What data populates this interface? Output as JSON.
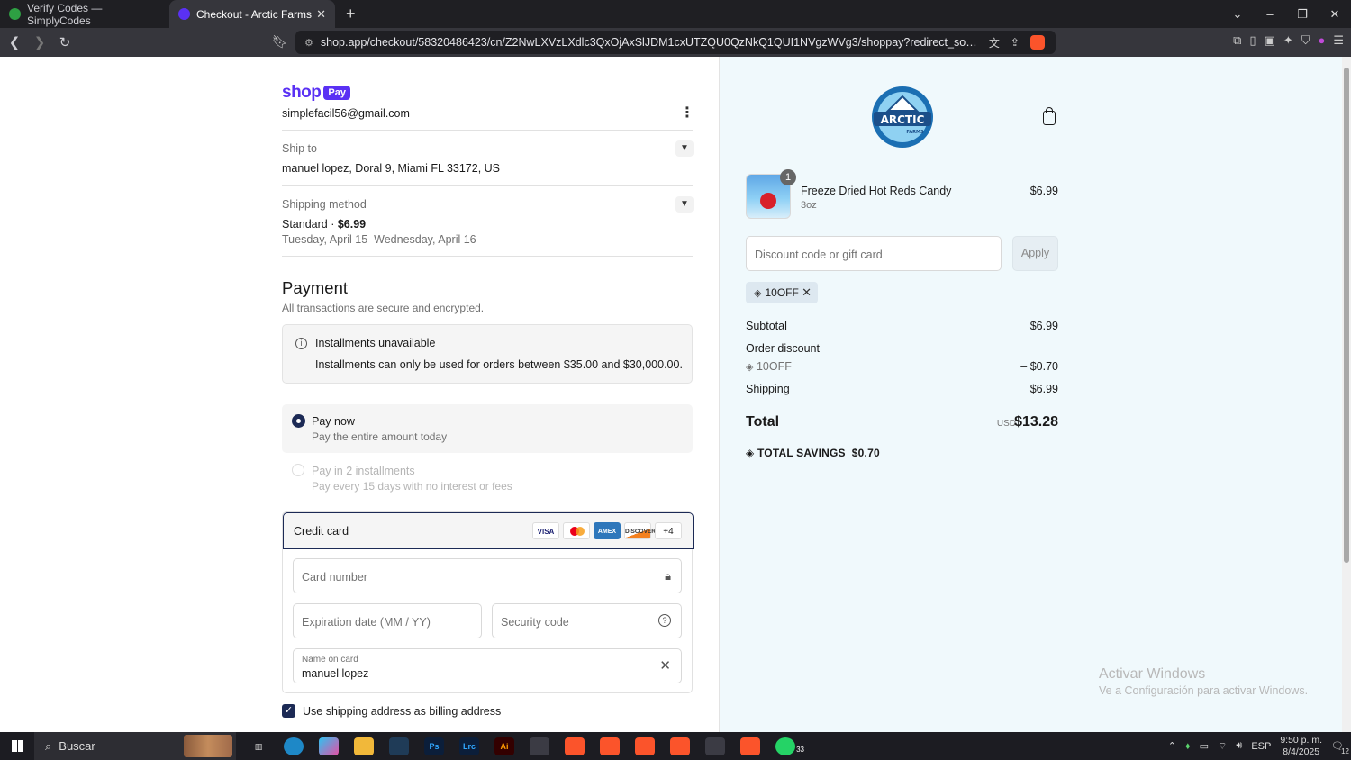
{
  "browser": {
    "tabs": [
      {
        "title": "Verify Codes — SimplyCodes",
        "color": "#2ea043"
      },
      {
        "title": "Checkout - Arctic Farms",
        "color": "#5a31f4"
      }
    ],
    "url": "shop.app/checkout/58320486423/cn/Z2NwLXVzLXdlc3QxOjAxSlJDM1cxUTZQU0QzNkQ1QUI1NVgzWVg3/shoppay?redirect_source=checkout_univer...",
    "brave_count": "2"
  },
  "shop": {
    "brand": "shop",
    "pay_badge": "Pay",
    "email": "simplefacil56@gmail.com",
    "ship_to_label": "Ship to",
    "ship_to_value": "manuel lopez, Doral 9, Miami FL 33172, US",
    "shipping_method_label": "Shipping method",
    "shipping_method_name": "Standard",
    "shipping_method_price": "$6.99",
    "shipping_dates": "Tuesday, April 15–Wednesday, April 16",
    "payment_title": "Payment",
    "payment_sub": "All transactions are secure and encrypted.",
    "installments_title": "Installments unavailable",
    "installments_text": "Installments can only be used for orders between $35.00 and $30,000.00.",
    "pay_now_title": "Pay now",
    "pay_now_sub": "Pay the entire amount today",
    "pay_install_title": "Pay in 2 installments",
    "pay_install_sub": "Pay every 15 days with no interest or fees",
    "credit_card_label": "Credit card",
    "card_brands": [
      "VISA",
      "",
      "AMEX",
      "DISCOVER"
    ],
    "more_cards": "+4",
    "card_number_ph": "Card number",
    "expiry_ph": "Expiration date (MM / YY)",
    "security_ph": "Security code",
    "name_label": "Name on card",
    "name_value": "manuel lopez",
    "billing_label": "Use shipping address as billing address"
  },
  "order": {
    "product_name": "Freeze Dried Hot Reds Candy",
    "product_variant": "3oz",
    "product_price": "$6.99",
    "quantity": "1",
    "discount_ph": "Discount code or gift card",
    "apply_label": "Apply",
    "applied_code": "10OFF",
    "subtotal_label": "Subtotal",
    "subtotal": "$6.99",
    "order_discount_label": "Order discount",
    "discount_code": "10OFF",
    "discount_amount": "– $0.70",
    "shipping_label": "Shipping",
    "shipping": "$6.99",
    "total_label": "Total",
    "currency": "USD",
    "total": "$13.28",
    "savings_label": "TOTAL SAVINGS",
    "savings_amount": "$0.70",
    "logo_text": "ARCTIC",
    "logo_sub": "FARMS"
  },
  "windows": {
    "watermark_title": "Activar Windows",
    "watermark_sub": "Ve a Configuración para activar Windows.",
    "search_label": "Buscar",
    "lang": "ESP",
    "time": "9:50 p. m.",
    "date": "8/4/2025",
    "whatsapp_badge": "33",
    "notif_count": "12"
  }
}
